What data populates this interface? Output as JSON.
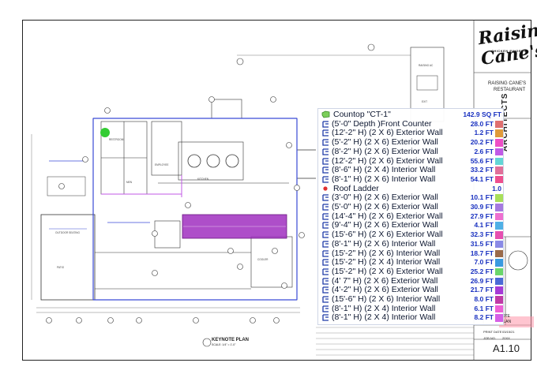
{
  "titleblock": {
    "logo_text": "Raising Cane's",
    "logo_sub": "CHICKEN FINGERS",
    "restaurant_line1": "RAISING CANE'S",
    "restaurant_line2": "RESTAURANT",
    "discipline": "ARCHITECTS",
    "sheet_number": "A1.10",
    "print_label": "PRINT DATE",
    "print_date": "03/15/21",
    "job_label": "JOB NO.",
    "job_no": "20XX",
    "note_text": "NOTE",
    "note_plan": "PLAN",
    "set_label": "KIT SET",
    "accent_color": "#ffb0c0"
  },
  "drawing": {
    "keynote_title": "KEYNOTE PLAN",
    "keynote_scale": "SCALE: 1/4\" = 1'-0\""
  },
  "takeoff": {
    "groups": [
      {
        "label": "Countop \"CT-1\"",
        "value": "142.9 SQ FT",
        "icon": "area-group-icon",
        "icon_color": "#7ccf5a",
        "items": [
          {
            "label": "(5'-0\" Depth )Front Counter",
            "value": "28.0 FT",
            "color": "#e07070"
          },
          {
            "label": "(12'-2\" H) (2 X 6) Exterior Wall",
            "value": "1.2 FT",
            "color": "#e09a3a"
          },
          {
            "label": "(5'-2\" H) (2 X 6) Exterior Wall",
            "value": "20.2 FT",
            "color": "#ee4fc6"
          },
          {
            "label": "(8'-2\" H) (2 X 6) Exterior Wall",
            "value": "2.6 FT",
            "color": "#c05ae6"
          },
          {
            "label": "(12'-2\" H) (2 X 6) Exterior Wall",
            "value": "55.6 FT",
            "color": "#63d6d6"
          },
          {
            "label": "(8'-6\" H) (2 X 4) Interior Wall",
            "value": "33.2 FT",
            "color": "#e0709a"
          },
          {
            "label": "(8'-1\" H) (2 X 6) Interior Wall",
            "value": "54.1 FT",
            "color": "#ee4f8e"
          }
        ]
      },
      {
        "label": "Roof Ladder",
        "value": "1.0",
        "icon": "count-group-icon",
        "icon_color": "#e03030",
        "items": [
          {
            "label": "(3'-0\" H) (2 X 6) Exterior Wall",
            "value": "10.1 FT",
            "color": "#a8df5a"
          },
          {
            "label": "(5'-0\" H) (2 X 6) Exterior Wall",
            "value": "30.9 FT",
            "color": "#a67ae0"
          },
          {
            "label": "(14'-4\" H) (2 X 6) Exterior Wall",
            "value": "27.9 FT",
            "color": "#ee6fd0"
          },
          {
            "label": "(9'-4\" H) (2 X 6) Exterior Wall",
            "value": "4.1 FT",
            "color": "#4fb0e6"
          },
          {
            "label": "(15'-6\" H) (2 X 6) Exterior Wall",
            "value": "32.3 FT",
            "color": "#e64fb0"
          },
          {
            "label": "(8'-1\" H) (2 X 6) Interior Wall",
            "value": "31.5 FT",
            "color": "#8a8ae6"
          },
          {
            "label": "(15'-2\" H) (2 X 6) Interior Wall",
            "value": "18.7 FT",
            "color": "#9a6a4a"
          },
          {
            "label": "(15'-2\" H) (2 X 4) Interior Wall",
            "value": "7.0 FT",
            "color": "#3a9ae0"
          },
          {
            "label": "(15'-2\" H) (2 X 6) Exterior Wall",
            "value": "25.2 FT",
            "color": "#6ad66a"
          },
          {
            "label": "(4' 7\" H) (2 X 6) Exterior Wall",
            "value": "26.9 FT",
            "color": "#4a6ad6"
          },
          {
            "label": "(4'-2\" H) (2 X 6) Exterior Wall",
            "value": "21.7 FT",
            "color": "#a63ad6"
          },
          {
            "label": "(15'-6\" H) (2 X 6) Interior Wall",
            "value": "8.0 FT",
            "color": "#c03aa6"
          },
          {
            "label": "(8'-1\" H) (2 X 4) Interior Wall",
            "value": "6.1 FT",
            "color": "#ee5fd6"
          },
          {
            "label": "(8'-1\" H) (2 X 4) Interior Wall",
            "value": "8.2 FT",
            "color": "#d65fe6"
          }
        ]
      }
    ]
  }
}
